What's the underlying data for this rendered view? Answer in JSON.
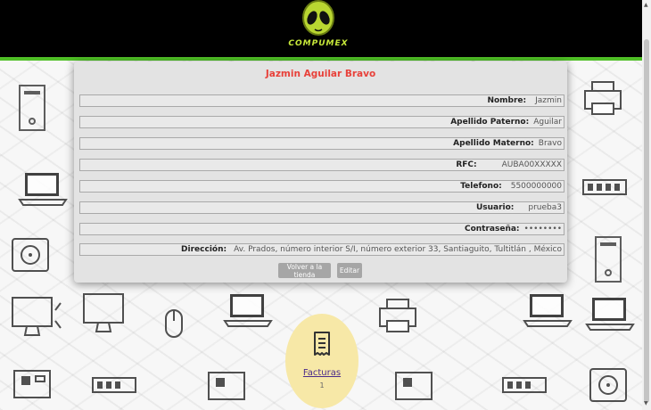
{
  "header": {
    "logo_text": "COMPUMEX",
    "logo_icon": "alien-head-icon",
    "accent_color": "#4fbf26"
  },
  "profile": {
    "full_name": "Jazmin Aguilar Bravo",
    "name_color": "#e8413a",
    "fields": [
      {
        "label": "Nombre:",
        "value": "Jazmin"
      },
      {
        "label": "Apellido Paterno:",
        "value": "Aguilar"
      },
      {
        "label": "Apellido Materno:",
        "value": "Bravo"
      },
      {
        "label": "RFC:",
        "value": "AUBA00XXXXX"
      },
      {
        "label": "Telefono:",
        "value": "5500000000"
      },
      {
        "label": "Usuario:",
        "value": "prueba3"
      },
      {
        "label": "Contraseña:",
        "value": "••••••••"
      },
      {
        "label": "Dirección:",
        "value": "Av. Prados, número interior  S/I, número exterior  33,  Santiaguito,  Tultitlán ,  México"
      }
    ]
  },
  "actions": {
    "back_label": "Volver a la tienda",
    "edit_label": "Editar"
  },
  "invoices": {
    "label": "Facturas",
    "count": "1",
    "icon": "receipt-icon"
  },
  "background_icons": [
    "computer-case-icon",
    "laptop-icon",
    "monitor-icon",
    "printer-icon",
    "hard-drive-icon",
    "mouse-icon",
    "ram-icon",
    "motherboard-icon"
  ]
}
